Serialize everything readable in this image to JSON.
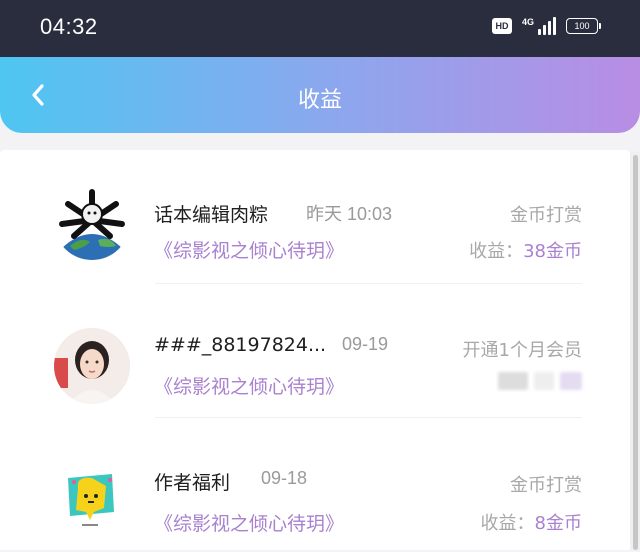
{
  "status_bar": {
    "time": "04:32",
    "hd": "HD",
    "network": "4G",
    "battery": "100"
  },
  "header": {
    "title": "收益"
  },
  "items": [
    {
      "name": "话本编辑肉粽",
      "date": "昨天 10:03",
      "work": "《综影视之倾心待玥》",
      "type": "金币打赏",
      "income_label": "收益：",
      "income_amount": "38金币",
      "avatar_icon": "space-figure-avatar"
    },
    {
      "name": "###_88197824...",
      "date": "09-19",
      "work": "《综影视之倾心待玥》",
      "type": "开通1个月会员",
      "income_label": "",
      "income_amount": "",
      "avatar_icon": "woman-photo-avatar"
    },
    {
      "name": "作者福利",
      "date": "09-18",
      "work": "《综影视之倾心待玥》",
      "type": "金币打赏",
      "income_label": "收益：",
      "income_amount": "8金币",
      "avatar_icon": "chat-bubble-mascot-avatar"
    }
  ],
  "colors": {
    "accent_purple": "#a981d0",
    "header_gradient_start": "#4ec6f2",
    "header_gradient_end": "#b88de4",
    "status_bar": "#2a2d3d"
  }
}
